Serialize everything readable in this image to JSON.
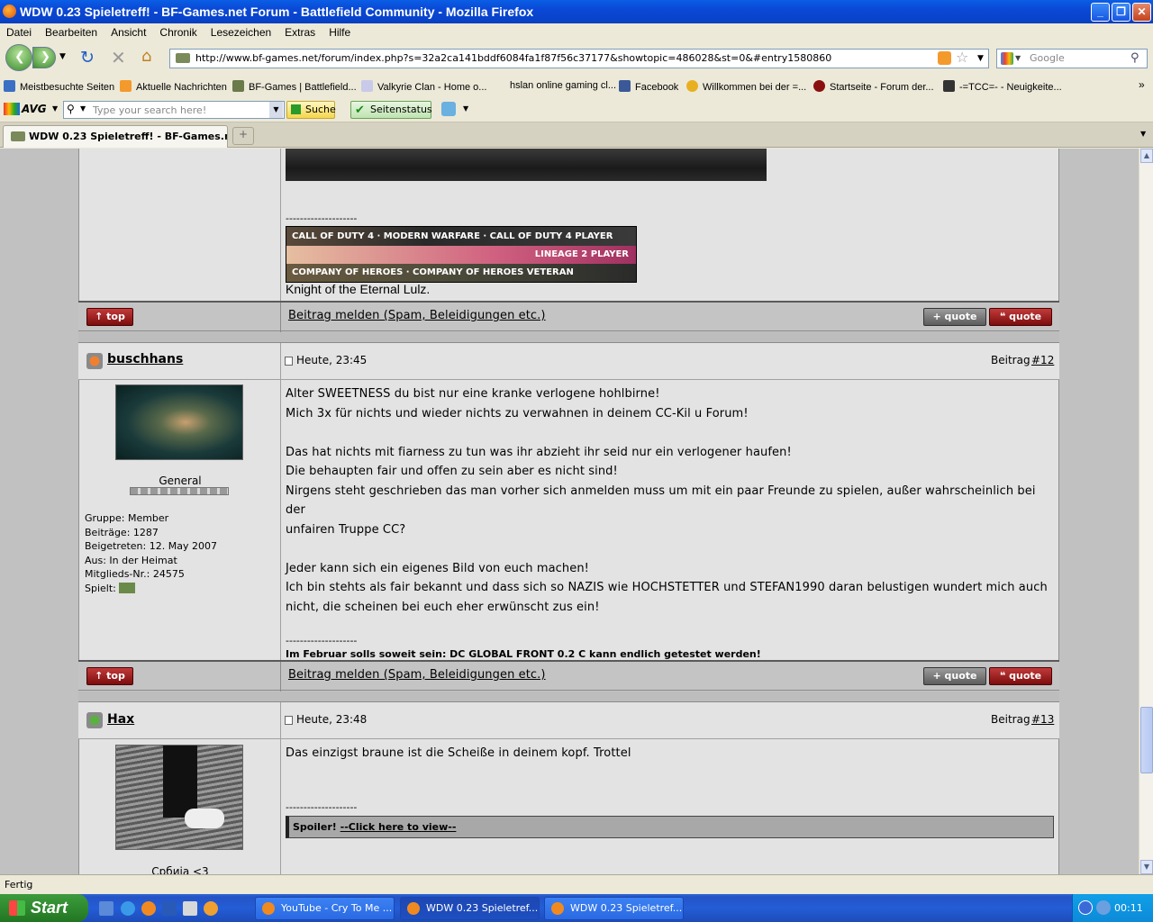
{
  "window": {
    "title": "WDW 0.23 Spieletreff! - BF-Games.net Forum - Battlefield Community - Mozilla Firefox"
  },
  "menu": [
    "Datei",
    "Bearbeiten",
    "Ansicht",
    "Chronik",
    "Lesezeichen",
    "Extras",
    "Hilfe"
  ],
  "nav": {
    "url": "http://www.bf-games.net/forum/index.php?s=32a2ca141bddf6084fa1f87f56c37177&showtopic=486028&st=0&#entry1580860",
    "search_placeholder": "Google"
  },
  "bookmarks": [
    "Meistbesuchte Seiten",
    "Aktuelle Nachrichten",
    "BF-Games | Battlefield...",
    "Valkyrie Clan - Home o...",
    "hslan online gaming cl...",
    "Facebook",
    "Willkommen bei der =...",
    "Startseite - Forum der...",
    "-=TCC=- - Neuigkeite..."
  ],
  "avg": {
    "logo": "AVG",
    "search_placeholder": "Type your search here!",
    "search_btn": "Suche",
    "status_btn": "Seitenstatus"
  },
  "tab": {
    "label": "WDW 0.23 Spieletreff! - BF-Games.ne..."
  },
  "prev_post": {
    "separator": "--------------------",
    "signature_text": "Knight of the Eternal Lulz.",
    "banners": [
      "CALL OF DUTY 4 · MODERN WARFARE · CALL OF DUTY 4 PLAYER",
      "LINEAGE 2 PLAYER",
      "COMPANY OF HEROES · COMPANY OF HEROES VETERAN"
    ]
  },
  "actions": {
    "top": "top",
    "report": "Beitrag melden (Spam, Beleidigungen etc.)",
    "quote": "quote"
  },
  "post12": {
    "username": "buschhans",
    "time": "Heute, 23:45",
    "beitrag_label": "Beitrag",
    "number": "#12",
    "rank": "General",
    "info": [
      "Gruppe: Member",
      "Beiträge: 1287",
      "Beigetreten: 12. May 2007",
      "Aus: In der Heimat",
      "Mitglieds-Nr.: 24575",
      "Spielt:"
    ],
    "body": [
      "Alter SWEETNESS du bist nur eine kranke verlogene hohlbirne!",
      "Mich 3x für nichts und wieder nichts zu verwahnen in deinem CC-Kil u Forum!",
      "",
      "Das hat nichts mit fiarness zu tun was ihr abzieht ihr seid nur ein verlogener haufen!",
      "Die behaupten fair und offen zu sein aber es nicht sind!",
      "Nirgens steht geschrieben das man vorher sich anmelden muss um mit ein paar Freunde zu spielen, außer wahrscheinlich bei der",
      "unfairen Truppe CC?",
      "",
      "Jeder kann sich ein eigenes Bild von euch machen!",
      "Ich bin stehts als fair bekannt und dass sich so NAZIS wie HOCHSTETTER und STEFAN1990 daran belustigen wundert mich auch",
      "nicht, die scheinen bei euch eher erwünscht zus ein!"
    ],
    "separator": "--------------------",
    "signature": "Im Februar solls soweit sein: DC GLOBAL FRONT 0.2 C kann endlich getestet werden!"
  },
  "post13": {
    "username": "Hax",
    "time": "Heute, 23:48",
    "beitrag_label": "Beitrag",
    "number": "#13",
    "body": "Das einzigst braune ist die Scheiße in deinem kopf. Trottel",
    "separator": "--------------------",
    "spoiler_label": "Spoiler!",
    "spoiler_link": "--Click here to view--",
    "location": "Србија <3"
  },
  "statusbar": {
    "text": "Fertig"
  },
  "taskbar": {
    "start": "Start",
    "tasks": [
      "YouTube - Cry To Me ...",
      "WDW 0.23 Spieletref...",
      "WDW 0.23 Spieletref..."
    ],
    "clock": "00:11"
  }
}
